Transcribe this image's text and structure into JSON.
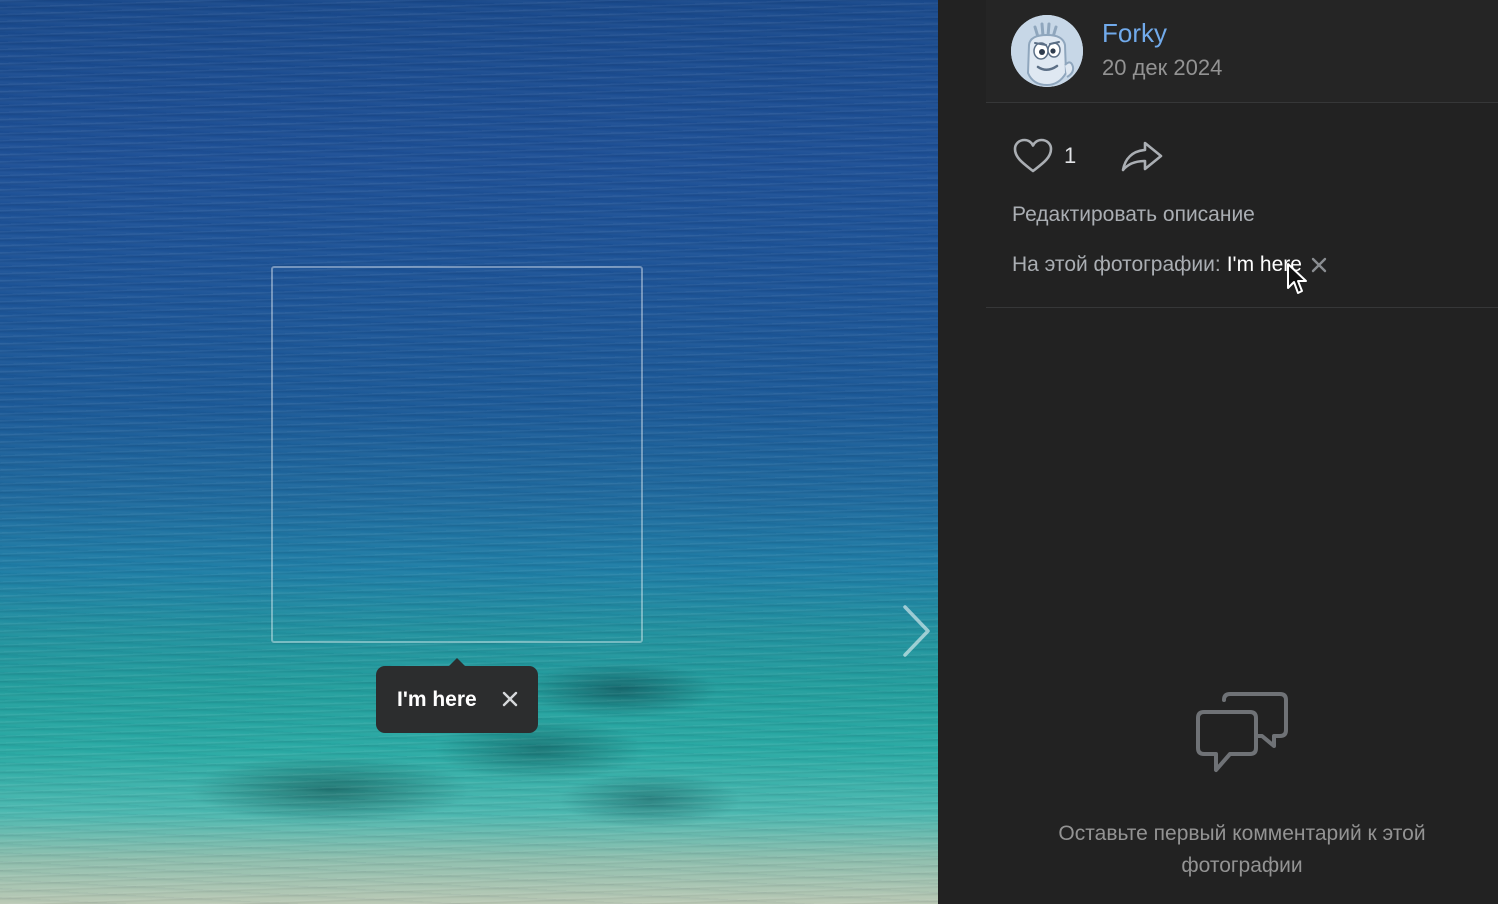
{
  "photo": {
    "tag": {
      "label": "I'm here"
    }
  },
  "post": {
    "author": "Forky",
    "date": "20 дек 2024",
    "likes": "1",
    "edit_description": "Редактировать описание",
    "on_photo_label": "На этой фотографии:",
    "tagged_name": "I'm here"
  },
  "comments": {
    "empty_text": "Оставьте первый комментарий к этой фотографии"
  },
  "colors": {
    "panel_bg": "#222222",
    "author_link": "#71aaeb",
    "tooltip_bg": "#2c2d2e"
  },
  "icons": [
    "heart-icon",
    "share-icon",
    "close-icon",
    "chevron-right-icon",
    "comments-icon",
    "cursor-icon"
  ]
}
